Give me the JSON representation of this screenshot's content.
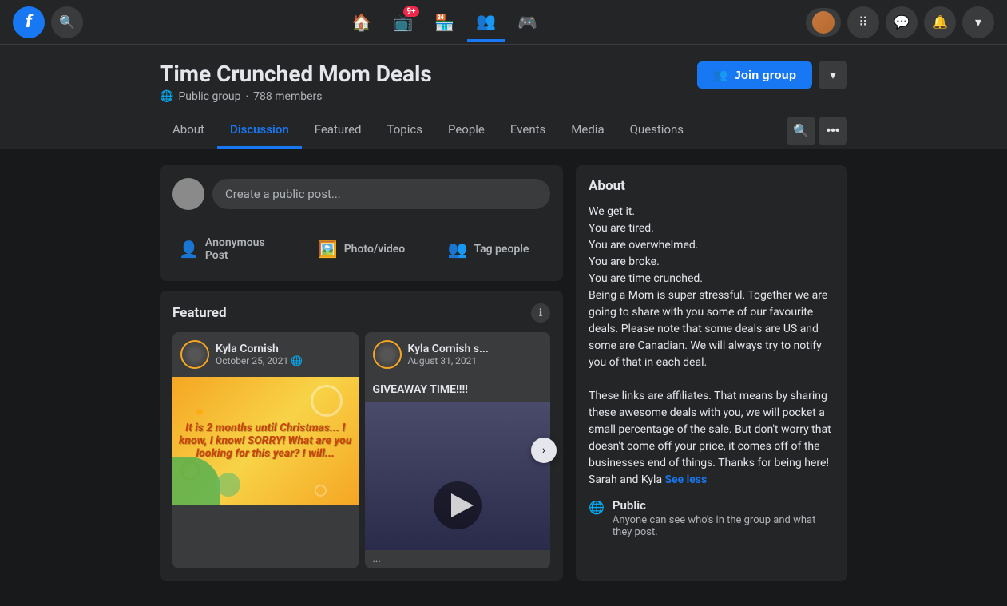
{
  "app": {
    "name": "Facebook",
    "logo_letter": "f"
  },
  "topnav": {
    "search_title": "Search Facebook",
    "notifications_badge": "9+",
    "nav_items": [
      {
        "id": "home",
        "icon": "🏠",
        "label": "Home",
        "active": false
      },
      {
        "id": "watch",
        "icon": "📺",
        "label": "Watch",
        "active": false,
        "badge": "9+"
      },
      {
        "id": "marketplace",
        "icon": "🏪",
        "label": "Marketplace",
        "active": false
      },
      {
        "id": "groups",
        "icon": "👥",
        "label": "Groups",
        "active": true
      },
      {
        "id": "gaming",
        "icon": "🎮",
        "label": "Gaming",
        "active": false
      }
    ],
    "dropdown_icon": "▾"
  },
  "group": {
    "name": "Time Crunched Mom Deals",
    "privacy": "Public group",
    "members_count": "788 members",
    "join_button_label": "Join group",
    "join_icon": "👥",
    "nav_tabs": [
      {
        "id": "about",
        "label": "About",
        "active": false
      },
      {
        "id": "discussion",
        "label": "Discussion",
        "active": true
      },
      {
        "id": "featured",
        "label": "Featured",
        "active": false
      },
      {
        "id": "topics",
        "label": "Topics",
        "active": false
      },
      {
        "id": "people",
        "label": "People",
        "active": false
      },
      {
        "id": "events",
        "label": "Events",
        "active": false
      },
      {
        "id": "media",
        "label": "Media",
        "active": false
      },
      {
        "id": "questions",
        "label": "Questions",
        "active": false
      }
    ]
  },
  "composer": {
    "placeholder": "Create a public post...",
    "actions": [
      {
        "id": "anonymous",
        "icon": "👤",
        "label": "Anonymous Post",
        "color": "#45b8f2"
      },
      {
        "id": "photo",
        "icon": "🖼️",
        "label": "Photo/video",
        "color": "#45c472"
      },
      {
        "id": "tag",
        "icon": "👥",
        "label": "Tag people",
        "color": "#5b9cf6"
      }
    ]
  },
  "featured": {
    "title": "Featured",
    "info_icon": "ℹ",
    "cards": [
      {
        "author": "Kyla Cornish",
        "date": "October 25, 2021",
        "privacy": "🌐",
        "image_text": "It is 2 months until Christmas... I know, I know! SORRY! What are you looking for this year? I will...",
        "type": "image"
      },
      {
        "author": "Kyla Cornish s...",
        "date": "August 31, 2021",
        "body_text": "GIVEAWAY TIME!!!!",
        "sub_text": "...",
        "type": "video"
      }
    ],
    "next_arrow": "›"
  },
  "about": {
    "title": "About",
    "description_lines": [
      "We get it.",
      "You are tired.",
      "You are overwhelmed.",
      "You are broke.",
      "You are time crunched.",
      "Being a Mom is super stressful. Together we are going to share with you some of our favourite deals. Please note that some deals are US and some are Canadian. We will always try to notify you of that in each deal.",
      "",
      "These links are affiliates. That means by sharing these awesome deals with you, we will pocket a small percentage of the sale. But don't worry that doesn't come off your price, it comes off of the businesses end of things. Thanks for being here!",
      "Sarah and Kyla"
    ],
    "see_less_label": "See less",
    "privacy_icon": "🌐",
    "privacy_label": "Public",
    "privacy_desc": "Anyone can see who's in the group and what they post."
  }
}
